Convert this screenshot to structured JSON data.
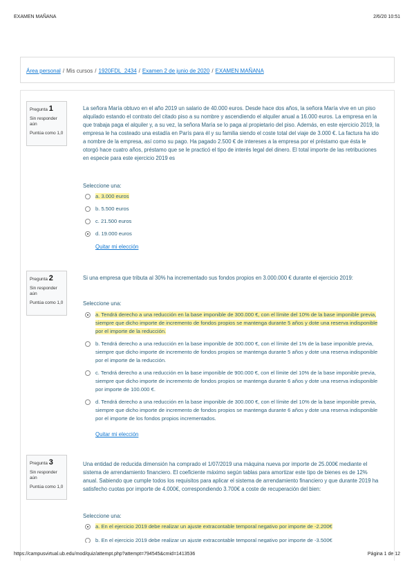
{
  "page_header": {
    "title": "EXAMEN MAÑANA",
    "datetime": "2/6/20 10:51"
  },
  "breadcrumb": {
    "items": [
      "Área personal",
      "Mis cursos",
      "1920FDL_2434",
      "Examen 2 de junio de 2020",
      "EXAMEN MAÑANA"
    ],
    "separator": "/"
  },
  "questions": [
    {
      "label": "Pregunta",
      "number": "1",
      "state": "Sin responder aún",
      "grade": "Puntúa como 1,0",
      "text": "La señora María obtuvo en el año 2019 un salario de 40.000 euros. Desde hace dos años, la señora María vive en un piso alquilado estando el contrato del citado piso a su nombre y ascendiendo el alquiler anual a 16.000 euros. La empresa en la que trabaja paga el alquiler y, a su vez, la señora María se lo paga al propietario del piso. Además, en este ejercicio 2019, la empresa le ha costeado una estadía en París para él y su familia siendo el coste total del viaje de 3.000 €. La factura ha ido a nombre de la empresa, así como su pago. Ha pagado 2.500 € de intereses a la empresa por el préstamo que ésta le otorgó hace cuatro años, préstamo que se le practicó el tipo de interés legal del dinero. El total importe de las retribuciones en especie para este ejercicio 2019 es",
      "prompt": "Seleccione una:",
      "options": [
        "a. 3.000 euros",
        "b. 5.500 euros",
        "c. 21.500 euros",
        "d. 19.000 euros"
      ],
      "clear_label": "Quitar mi elección"
    },
    {
      "label": "Pregunta",
      "number": "2",
      "state": "Sin responder aún",
      "grade": "Puntúa como 1,0",
      "text": "Si una empresa que tributa al 30% ha incrementado sus fondos propios en 3.000.000 € durante el ejercicio 2019:",
      "prompt": "Seleccione una:",
      "options": [
        "a. Tendrá derecho a una reducción en la base imponible de 300.000 €, con el límite del 10% de la base imponible previa, siempre que dicho importe de incremento de fondos propios se mantenga durante 5 años y dote una reserva indisponible por el importe de la reducción.",
        "b. Tendrá derecho a una reducción en la base imponible de 300.000 €, con el límite del 1% de la base imponible previa, siempre que dicho importe de incremento de fondos propios se mantenga durante 5 años y dote una reserva indisponible por el importe de la reducción.",
        "c. Tendrá derecho a una reducción en la base imponible de 900.000 €, con el límite del 10% de la base imponible previa, siempre que dicho importe de incremento de fondos propios se mantenga durante 6 años y dote una reserva indisponible por importe de 100.000 €.",
        "d. Tendrá derecho a una reducción en la base imponible de 300.000 €, con el límite del 10% de la base imponible previa, siempre que dicho importe de incremento de fondos propios se mantenga durante 6 años y dote una reserva indisponible por el importe de los fondos propios incrementados."
      ],
      "clear_label": "Quitar mi elección"
    },
    {
      "label": "Pregunta",
      "number": "3",
      "state": "Sin responder aún",
      "grade": "Puntúa como 1,0",
      "text": "Una entidad de reducida dimensión ha comprado el 1/07/2019 una máquina nueva por importe de 25.000€ mediante el sistema de arrendamiento financiero. El coeficiente máximo según tablas para amortizar este tipo de bienes es de 12% anual. Sabiendo que cumple todos los requisitos para aplicar el sistema de arrendamiento financiero y que durante 2019 ha satisfecho cuotas por importe de 4.000€, correspondiendo 3.700€ a coste de recuperación del bien:",
      "prompt": "Seleccione una:",
      "options": [
        "a. En el ejercicio 2019 debe realizar un ajuste extracontable temporal negativo por importe de -2.200€",
        "b. En el ejercicio 2019 debe realizar un ajuste extracontable temporal negativo por importe de -3.500€"
      ]
    }
  ],
  "page_footer": {
    "url": "https://campusvirtual.ub.edu/mod/quiz/attempt.php?attempt=794545&cmid=1413536",
    "page": "Página 1 de 12"
  },
  "colors": {
    "link": "#1177d1",
    "question_text": "#2b5f7a",
    "highlight": "#fff3a3"
  }
}
